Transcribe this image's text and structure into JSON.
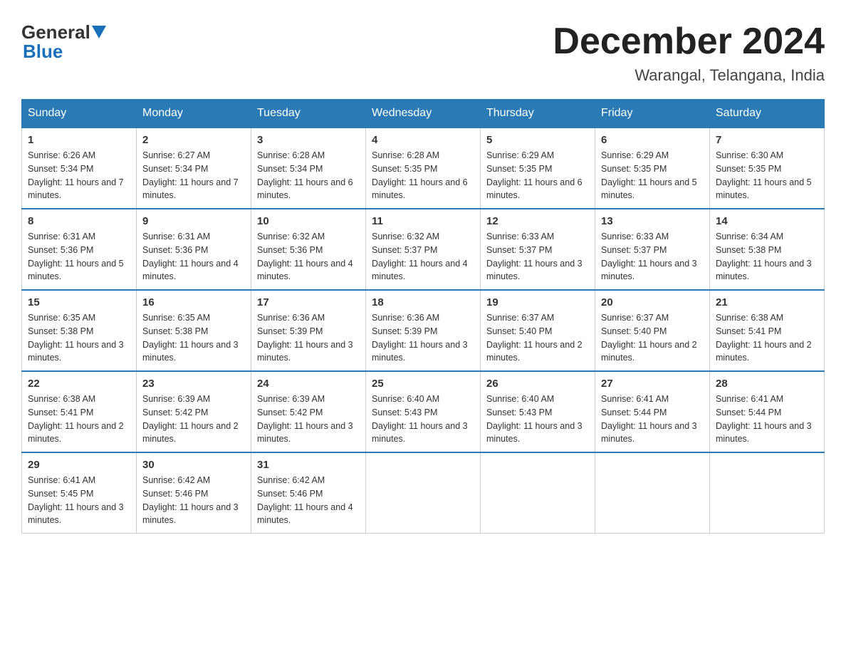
{
  "header": {
    "logo_general": "General",
    "logo_blue": "Blue",
    "main_title": "December 2024",
    "subtitle": "Warangal, Telangana, India"
  },
  "days_of_week": [
    "Sunday",
    "Monday",
    "Tuesday",
    "Wednesday",
    "Thursday",
    "Friday",
    "Saturday"
  ],
  "weeks": [
    [
      {
        "day": "1",
        "sunrise": "6:26 AM",
        "sunset": "5:34 PM",
        "daylight": "11 hours and 7 minutes."
      },
      {
        "day": "2",
        "sunrise": "6:27 AM",
        "sunset": "5:34 PM",
        "daylight": "11 hours and 7 minutes."
      },
      {
        "day": "3",
        "sunrise": "6:28 AM",
        "sunset": "5:34 PM",
        "daylight": "11 hours and 6 minutes."
      },
      {
        "day": "4",
        "sunrise": "6:28 AM",
        "sunset": "5:35 PM",
        "daylight": "11 hours and 6 minutes."
      },
      {
        "day": "5",
        "sunrise": "6:29 AM",
        "sunset": "5:35 PM",
        "daylight": "11 hours and 6 minutes."
      },
      {
        "day": "6",
        "sunrise": "6:29 AM",
        "sunset": "5:35 PM",
        "daylight": "11 hours and 5 minutes."
      },
      {
        "day": "7",
        "sunrise": "6:30 AM",
        "sunset": "5:35 PM",
        "daylight": "11 hours and 5 minutes."
      }
    ],
    [
      {
        "day": "8",
        "sunrise": "6:31 AM",
        "sunset": "5:36 PM",
        "daylight": "11 hours and 5 minutes."
      },
      {
        "day": "9",
        "sunrise": "6:31 AM",
        "sunset": "5:36 PM",
        "daylight": "11 hours and 4 minutes."
      },
      {
        "day": "10",
        "sunrise": "6:32 AM",
        "sunset": "5:36 PM",
        "daylight": "11 hours and 4 minutes."
      },
      {
        "day": "11",
        "sunrise": "6:32 AM",
        "sunset": "5:37 PM",
        "daylight": "11 hours and 4 minutes."
      },
      {
        "day": "12",
        "sunrise": "6:33 AM",
        "sunset": "5:37 PM",
        "daylight": "11 hours and 3 minutes."
      },
      {
        "day": "13",
        "sunrise": "6:33 AM",
        "sunset": "5:37 PM",
        "daylight": "11 hours and 3 minutes."
      },
      {
        "day": "14",
        "sunrise": "6:34 AM",
        "sunset": "5:38 PM",
        "daylight": "11 hours and 3 minutes."
      }
    ],
    [
      {
        "day": "15",
        "sunrise": "6:35 AM",
        "sunset": "5:38 PM",
        "daylight": "11 hours and 3 minutes."
      },
      {
        "day": "16",
        "sunrise": "6:35 AM",
        "sunset": "5:38 PM",
        "daylight": "11 hours and 3 minutes."
      },
      {
        "day": "17",
        "sunrise": "6:36 AM",
        "sunset": "5:39 PM",
        "daylight": "11 hours and 3 minutes."
      },
      {
        "day": "18",
        "sunrise": "6:36 AM",
        "sunset": "5:39 PM",
        "daylight": "11 hours and 3 minutes."
      },
      {
        "day": "19",
        "sunrise": "6:37 AM",
        "sunset": "5:40 PM",
        "daylight": "11 hours and 2 minutes."
      },
      {
        "day": "20",
        "sunrise": "6:37 AM",
        "sunset": "5:40 PM",
        "daylight": "11 hours and 2 minutes."
      },
      {
        "day": "21",
        "sunrise": "6:38 AM",
        "sunset": "5:41 PM",
        "daylight": "11 hours and 2 minutes."
      }
    ],
    [
      {
        "day": "22",
        "sunrise": "6:38 AM",
        "sunset": "5:41 PM",
        "daylight": "11 hours and 2 minutes."
      },
      {
        "day": "23",
        "sunrise": "6:39 AM",
        "sunset": "5:42 PM",
        "daylight": "11 hours and 2 minutes."
      },
      {
        "day": "24",
        "sunrise": "6:39 AM",
        "sunset": "5:42 PM",
        "daylight": "11 hours and 3 minutes."
      },
      {
        "day": "25",
        "sunrise": "6:40 AM",
        "sunset": "5:43 PM",
        "daylight": "11 hours and 3 minutes."
      },
      {
        "day": "26",
        "sunrise": "6:40 AM",
        "sunset": "5:43 PM",
        "daylight": "11 hours and 3 minutes."
      },
      {
        "day": "27",
        "sunrise": "6:41 AM",
        "sunset": "5:44 PM",
        "daylight": "11 hours and 3 minutes."
      },
      {
        "day": "28",
        "sunrise": "6:41 AM",
        "sunset": "5:44 PM",
        "daylight": "11 hours and 3 minutes."
      }
    ],
    [
      {
        "day": "29",
        "sunrise": "6:41 AM",
        "sunset": "5:45 PM",
        "daylight": "11 hours and 3 minutes."
      },
      {
        "day": "30",
        "sunrise": "6:42 AM",
        "sunset": "5:46 PM",
        "daylight": "11 hours and 3 minutes."
      },
      {
        "day": "31",
        "sunrise": "6:42 AM",
        "sunset": "5:46 PM",
        "daylight": "11 hours and 4 minutes."
      },
      null,
      null,
      null,
      null
    ]
  ]
}
